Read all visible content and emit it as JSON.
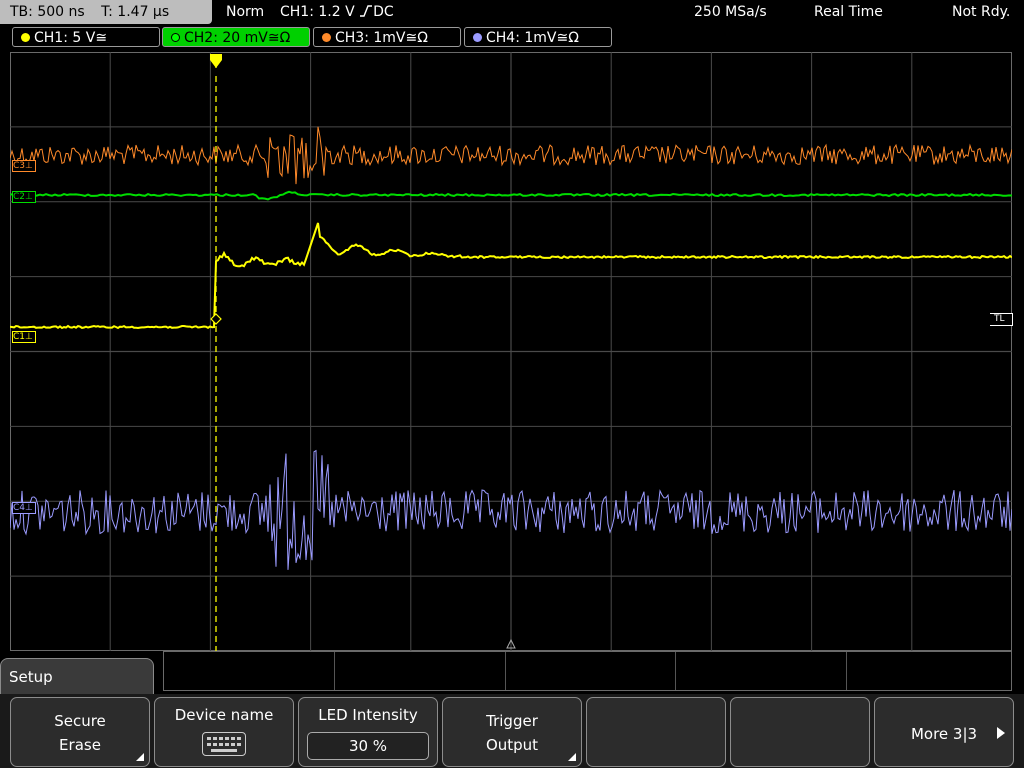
{
  "status": {
    "timebase": "TB: 500 ns",
    "trigger_time": "T: 1.47 µs",
    "mode": "Norm",
    "trigger_source": "CH1: 1.2 V",
    "trigger_coupling": "DC",
    "sample_rate": "250 MSa/s",
    "acq_mode": "Real Time",
    "state": "Not Rdy."
  },
  "channels": [
    {
      "label": "CH1: 5 V",
      "suffix": "≅",
      "color": "#ffff00"
    },
    {
      "label": "CH2: 20 mV",
      "suffix": "≅Ω",
      "color": "#00dd00"
    },
    {
      "label": "CH3: 1mV",
      "suffix": "≅Ω",
      "color": "#ff8a2a"
    },
    {
      "label": "CH4: 1mV",
      "suffix": "≅Ω",
      "color": "#9b9bff"
    }
  ],
  "markers": {
    "c3": "C3",
    "c2": "C2",
    "c1": "C1",
    "c4": "C4",
    "trigger_level": "TL"
  },
  "menu": {
    "title": "Setup",
    "softkeys": [
      {
        "line1": "Secure",
        "line2": "Erase"
      },
      {
        "line1": "Device name",
        "line2": ""
      },
      {
        "line1": "LED Intensity",
        "line2": "30 %"
      },
      {
        "line1": "Trigger",
        "line2": "Output"
      },
      {
        "line1": "",
        "line2": ""
      },
      {
        "line1": "",
        "line2": ""
      },
      {
        "line1": "More 3|3",
        "line2": ""
      }
    ]
  },
  "colors": {
    "grid": "#4a4a4a",
    "trigger_line": "#ffff00"
  },
  "icons": {
    "device_name": "keyboard-icon",
    "more": "right-arrow-icon",
    "trigger_pos": "trigger-position-marker-icon"
  }
}
